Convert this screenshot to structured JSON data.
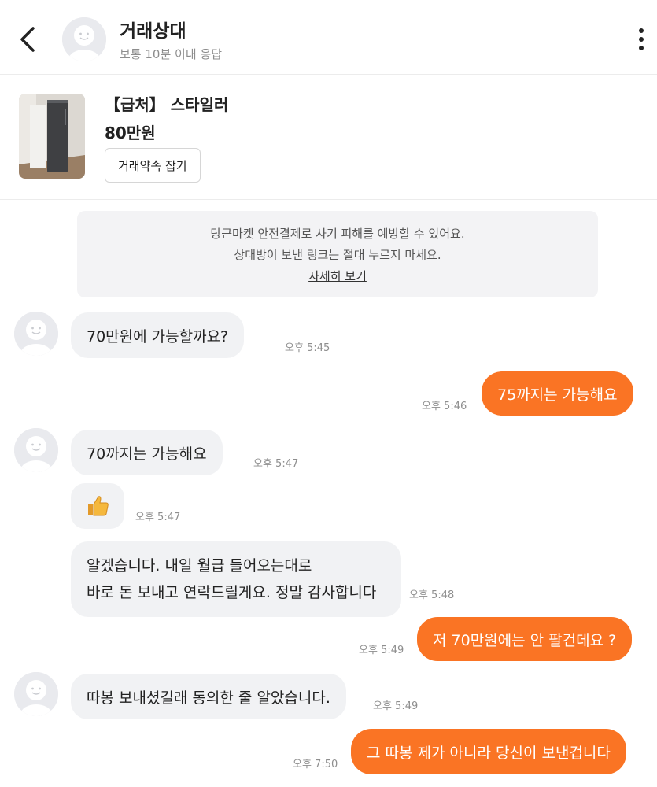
{
  "header": {
    "back_icon": "chevron-left-icon",
    "partner_name": "거래상대",
    "response_time": "보통 10분 이내 응답",
    "more_icon": "more-vertical-icon"
  },
  "product": {
    "title": "【급처】 스타일러",
    "price": "80만원",
    "appointment_button": "거래약속 잡기"
  },
  "notice": {
    "line1": "당근마켓 안전결제로 사기 피해를 예방할 수 있어요.",
    "line2": "상대방이 보낸 링크는 절대 누르지 마세요.",
    "link": "자세히 보기"
  },
  "messages": [
    {
      "from": "partner",
      "text": "70만원에 가능할까요?",
      "time": "오후 5:45"
    },
    {
      "from": "me",
      "text": "75까지는 가능해요",
      "time": "오후 5:46"
    },
    {
      "from": "partner",
      "text": "70까지는 가능해요",
      "time": "오후 5:47"
    },
    {
      "from": "partner",
      "text": "👍",
      "time": "오후 5:47"
    },
    {
      "from": "partner",
      "text_line1": "알겠습니다. 내일 월급 들어오는대로",
      "text_line2": "바로 돈 보내고 연락드릴게요. 정말 감사합니다",
      "time": "오후 5:48"
    },
    {
      "from": "me",
      "text": "저 70만원에는 안 팔건데요 ?",
      "time": "오후 5:49"
    },
    {
      "from": "partner",
      "text": "따봉 보내셨길래 동의한 줄 알았습니다.",
      "time": "오후 5:49"
    },
    {
      "from": "me",
      "text": "그 따봉 제가 아니라 당신이 보낸겁니다",
      "time": "오후 7:50"
    }
  ],
  "colors": {
    "accent": "#fa7424",
    "incoming_bubble": "#f1f2f4",
    "notice_bg": "#f3f3f5"
  }
}
